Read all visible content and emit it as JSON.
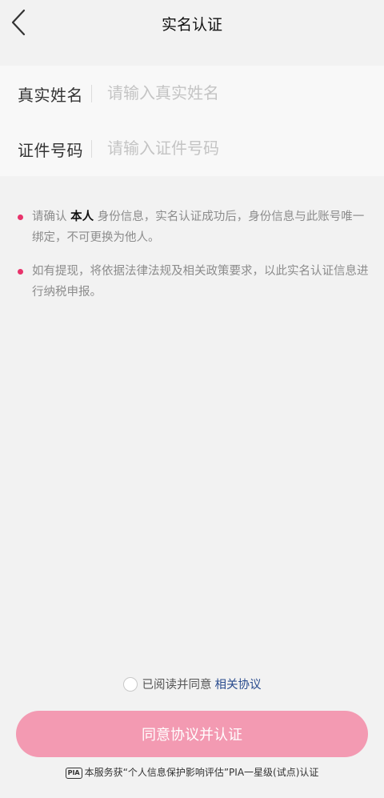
{
  "header": {
    "title": "实名认证"
  },
  "form": {
    "name_label": "真实姓名",
    "name_placeholder": "请输入真实姓名",
    "name_value": "",
    "id_label": "证件号码",
    "id_placeholder": "请输入证件号码",
    "id_value": ""
  },
  "notes": {
    "note1_prefix": "请确认 ",
    "note1_bold": "本人",
    "note1_suffix": " 身份信息，实名认证成功后，身份信息与此账号唯一绑定，不可更换为他人。",
    "note2": "如有提现，将依据法律法规及相关政策要求，以此实名认证信息进行纳税申报。"
  },
  "agreement": {
    "text": "已阅读并同意",
    "link": "相关协议",
    "checked": false
  },
  "submit_label": "同意协议并认证",
  "pia": {
    "badge": "PIA",
    "text": "本服务获“个人信息保护影响评估”PIA一星级(试点)认证"
  },
  "colors": {
    "accent": "#e8336b",
    "button": "#f39ab2",
    "link": "#2a4c8e",
    "background": "#f2f2f2"
  }
}
